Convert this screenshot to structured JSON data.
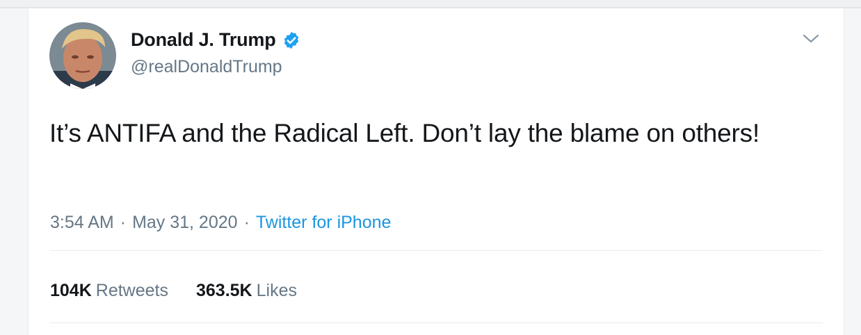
{
  "tweet": {
    "author": {
      "display_name": "Donald J. Trump",
      "handle": "@realDonaldTrump",
      "verified": true
    },
    "text": "It’s ANTIFA and the Radical Left. Don’t lay the blame on others!",
    "meta": {
      "time": "3:54 AM",
      "separator": "·",
      "date": "May 31, 2020",
      "source": "Twitter for iPhone"
    },
    "stats": {
      "retweets_count": "104K",
      "retweets_label": "Retweets",
      "likes_count": "363.5K",
      "likes_label": "Likes"
    }
  },
  "colors": {
    "verified_blue": "#1da1f2",
    "link_blue": "#1b95e0",
    "secondary_text": "#657786",
    "primary_text": "#14171a"
  },
  "icons": {
    "verified": "verified-badge-icon",
    "menu": "chevron-down-icon"
  }
}
